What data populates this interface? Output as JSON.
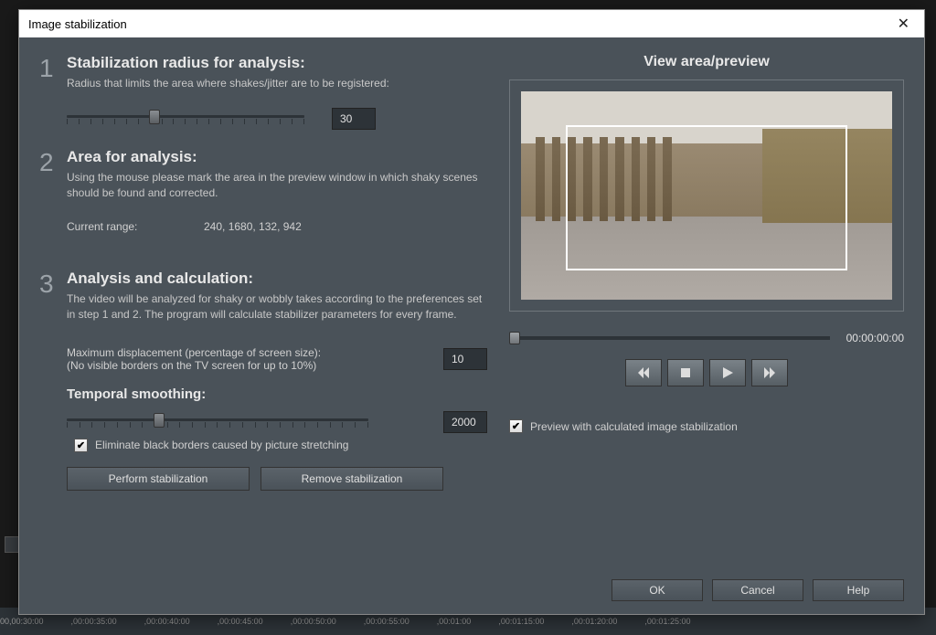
{
  "dialog": {
    "title": "Image stabilization"
  },
  "step1": {
    "num": "1",
    "heading": "Stabilization radius for analysis:",
    "desc": "Radius that limits the area where shakes/jitter are to be registered:",
    "value": "30"
  },
  "step2": {
    "num": "2",
    "heading": "Area for analysis:",
    "desc": "Using the mouse please mark the area in the preview window in which shaky scenes should be found and corrected.",
    "range_label": "Current range:",
    "range_value": "240, 1680, 132, 942"
  },
  "step3": {
    "num": "3",
    "heading": "Analysis and calculation:",
    "desc": "The video will be analyzed for shaky or wobbly takes according to the preferences set in step 1 and 2. The program will calculate stabilizer parameters for every frame.",
    "displacement_label": "Maximum displacement (percentage of screen size):",
    "displacement_hint": "(No visible borders on the TV screen for up to 10%)",
    "displacement_value": "10",
    "smoothing_label": "Temporal smoothing:",
    "smoothing_value": "2000",
    "checkbox_label": "Eliminate black borders caused by picture stretching",
    "perform_btn": "Perform stabilization",
    "remove_btn": "Remove stabilization"
  },
  "preview": {
    "heading": "View area/preview",
    "timecode": "00:00:00:00",
    "checkbox_label": "Preview with calculated image stabilization"
  },
  "footer": {
    "ok": "OK",
    "cancel": "Cancel",
    "help": "Help"
  },
  "timeline": {
    "marks": [
      "00,00:30:00",
      ",00:00:35:00",
      ",00:00:40:00",
      ",00:00:45:00",
      ",00:00:50:00",
      ",00:00:55:00",
      ",00:01:00",
      ",00:01:15:00",
      ",00:01:20:00",
      ",00:01:25:00"
    ]
  }
}
